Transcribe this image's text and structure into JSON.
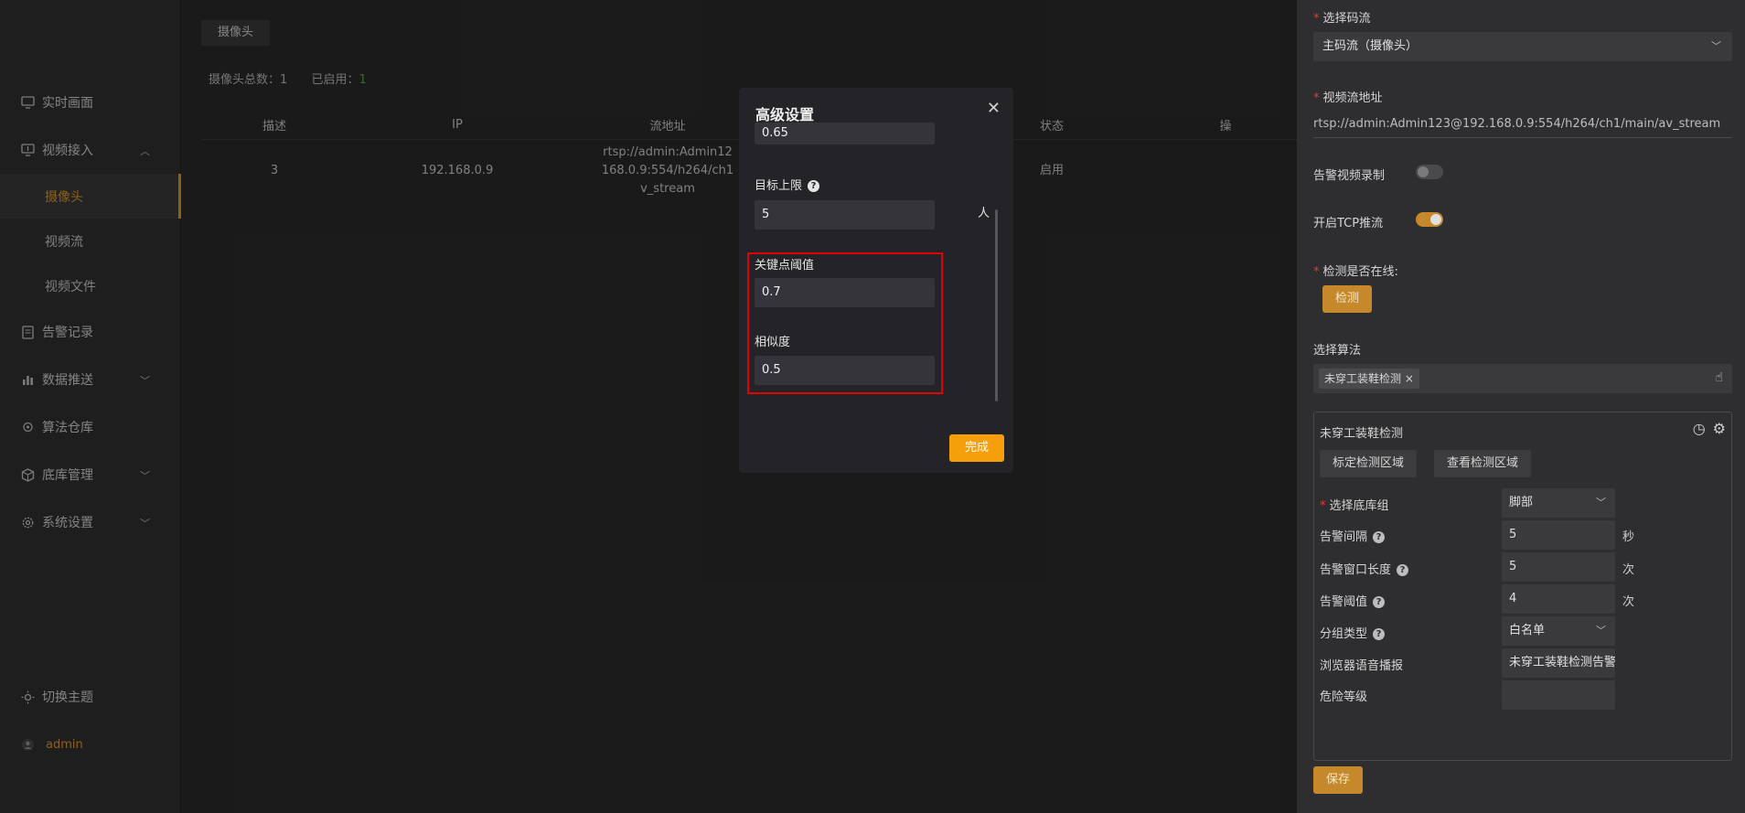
{
  "sidebar": {
    "items": [
      {
        "label": "实时画面",
        "icon": "monitor-icon"
      },
      {
        "label": "视频接入",
        "icon": "video-input-icon",
        "expanded": true,
        "children": [
          {
            "label": "摄像头",
            "active": true
          },
          {
            "label": "视频流"
          },
          {
            "label": "视频文件"
          }
        ]
      },
      {
        "label": "告警记录",
        "icon": "document-icon"
      },
      {
        "label": "数据推送",
        "icon": "chart-icon"
      },
      {
        "label": "算法仓库",
        "icon": "algorithm-icon"
      },
      {
        "label": "底库管理",
        "icon": "box-icon"
      },
      {
        "label": "系统设置",
        "icon": "gear-icon"
      }
    ],
    "bottom": {
      "theme_label": "切换主题",
      "user_name": "admin"
    }
  },
  "main": {
    "tab_label": "摄像头",
    "stats": {
      "total_label": "摄像头总数：",
      "total_value": "1",
      "enabled_label": "已启用：",
      "enabled_value": "1"
    },
    "table": {
      "headers": [
        "描述",
        "IP",
        "流地址",
        "",
        "状态",
        "操"
      ],
      "rows": [
        [
          "3",
          "192.168.0.9",
          "rtsp://admin:Admin12 168.0.9:554/h264/ch1 v_stream",
          "",
          "启用",
          ""
        ]
      ],
      "stream_lines": [
        "rtsp://admin:Admin12",
        "168.0.9:554/h264/ch1",
        "v_stream"
      ]
    }
  },
  "modal": {
    "title": "高级设置",
    "top_value": "0.65",
    "target_limit_label": "目标上限",
    "target_limit_value": "5",
    "target_limit_unit": "人",
    "keypoint_label": "关键点阈值",
    "keypoint_value": "0.7",
    "similarity_label": "相似度",
    "similarity_value": "0.5",
    "done_label": "完成"
  },
  "panel": {
    "stream_select_label": "选择码流",
    "stream_select_value": "主码流（摄像头）",
    "stream_url_label": "视频流地址",
    "stream_url_value": "rtsp://admin:Admin123@192.168.0.9:554/h264/ch1/main/av_stream",
    "alarm_record_label": "告警视频录制",
    "alarm_record_on": false,
    "tcp_label": "开启TCP推流",
    "tcp_on": true,
    "online_label": "检测是否在线:",
    "detect_button": "检测",
    "algo_label": "选择算法",
    "algo_tag": "未穿工装鞋检测",
    "algo_card": {
      "title": "未穿工装鞋检测",
      "mark_area_button": "标定检测区域",
      "view_area_button": "查看检测区域",
      "rows": {
        "library_group_label": "选择底库组",
        "library_group_value": "脚部",
        "interval_label": "告警间隔",
        "interval_value": "5",
        "interval_unit": "秒",
        "window_label": "告警窗口长度",
        "window_value": "5",
        "window_unit": "次",
        "threshold_label": "告警阈值",
        "threshold_value": "4",
        "threshold_unit": "次",
        "group_type_label": "分组类型",
        "group_type_value": "白名单",
        "voice_label": "浏览器语音播报",
        "voice_value": "未穿工装鞋检测告警",
        "danger_label": "危险等级",
        "danger_value": ""
      }
    },
    "save_button": "保存"
  },
  "colors": {
    "accent": "#e59a2a",
    "primary_button": "#f59f0b",
    "highlight_border": "#e00000"
  }
}
